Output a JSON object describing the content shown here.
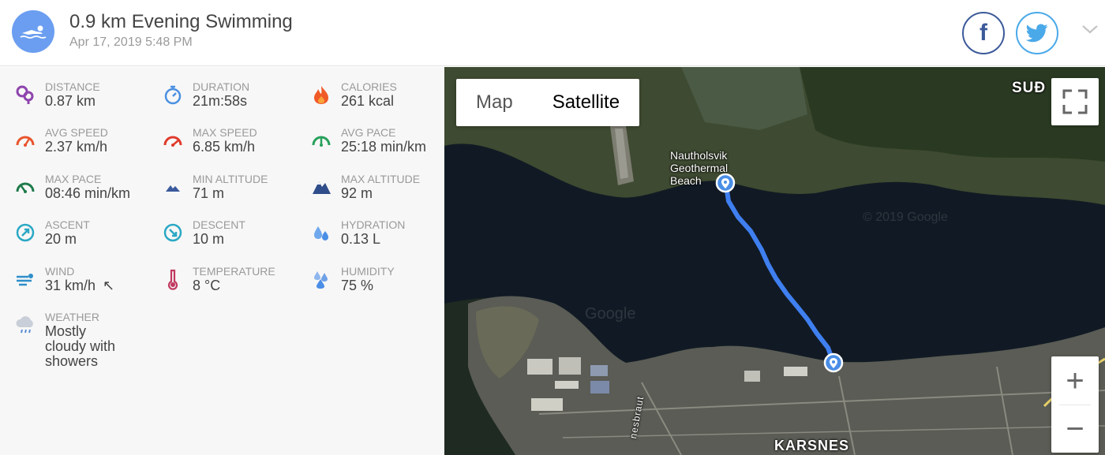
{
  "activity": {
    "title": "0.9 km Evening Swimming",
    "date": "Apr 17, 2019 5:48 PM",
    "icon": "swimmer-icon"
  },
  "share": {
    "facebook_icon": "facebook-icon",
    "facebook_glyph": "f",
    "twitter_icon": "twitter-icon",
    "expand_icon": "chevron-down-icon"
  },
  "stats": {
    "distance": {
      "label": "DISTANCE",
      "value": "0.87 km",
      "icon": "distance-icon"
    },
    "duration": {
      "label": "DURATION",
      "value": "21m:58s",
      "icon": "stopwatch-icon"
    },
    "calories": {
      "label": "CALORIES",
      "value": "261 kcal",
      "icon": "flame-icon"
    },
    "avg_speed": {
      "label": "AVG SPEED",
      "value": "2.37 km/h",
      "icon": "speedometer-icon"
    },
    "max_speed": {
      "label": "MAX SPEED",
      "value": "6.85 km/h",
      "icon": "speedometer-icon"
    },
    "avg_pace": {
      "label": "AVG PACE",
      "value": "25:18 min/km",
      "icon": "pace-gauge-icon"
    },
    "max_pace": {
      "label": "MAX PACE",
      "value": "08:46 min/km",
      "icon": "pace-gauge-icon"
    },
    "min_altitude": {
      "label": "MIN ALTITUDE",
      "value": "71 m",
      "icon": "mountain-icon"
    },
    "max_altitude": {
      "label": "MAX ALTITUDE",
      "value": "92 m",
      "icon": "mountain-icon"
    },
    "ascent": {
      "label": "ASCENT",
      "value": "20 m",
      "icon": "ascent-arrow-icon"
    },
    "descent": {
      "label": "DESCENT",
      "value": "10 m",
      "icon": "descent-arrow-icon"
    },
    "hydration": {
      "label": "HYDRATION",
      "value": "0.13 L",
      "icon": "water-drops-icon"
    },
    "wind": {
      "label": "WIND",
      "value": "31 km/h",
      "direction_glyph": "↖",
      "icon": "wind-icon"
    },
    "temperature": {
      "label": "TEMPERATURE",
      "value": "8 °C",
      "icon": "thermometer-icon"
    },
    "humidity": {
      "label": "HUMIDITY",
      "value": "75 %",
      "icon": "humidity-drops-icon"
    },
    "weather": {
      "label": "WEATHER",
      "value_line1": "Mostly",
      "value_line2": "cloudy with",
      "value_line3": "showers",
      "icon": "cloud-rain-icon"
    }
  },
  "map": {
    "type_options": [
      "Map",
      "Satellite"
    ],
    "selected_type": "Satellite",
    "labels": {
      "poi_line1": "Nautholsvik",
      "poi_line2": "Geothermal",
      "poi_line3": "Beach",
      "area_top_right": "SUÐ",
      "area_bottom": "KARSNES",
      "street": "nesbraut",
      "watermark": "© 2019 Google",
      "watermark2": "Google"
    },
    "zoom_in": "+",
    "zoom_out": "−",
    "route_color": "#3f7ff0",
    "start_marker_icon": "map-pin-icon",
    "end_marker_icon": "map-pin-icon",
    "fullscreen_icon": "fullscreen-icon"
  }
}
